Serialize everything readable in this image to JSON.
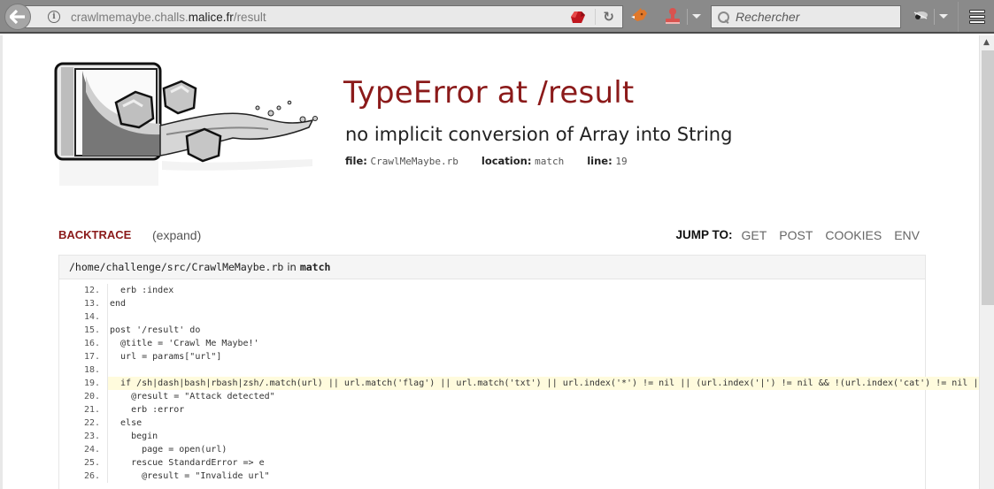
{
  "browser": {
    "url_prefix": "crawlmemaybe.challs.",
    "url_domain": "malice.fr",
    "url_suffix": "/result",
    "search_placeholder": "Rechercher"
  },
  "error": {
    "title": "TypeError at /result",
    "message": "no implicit conversion of Array into String",
    "file_label": "file:",
    "file": "CrawlMeMaybe.rb",
    "location_label": "location:",
    "location": "match",
    "line_label": "line:",
    "line": "19"
  },
  "backtrace": {
    "label": "BACKTRACE",
    "expand": "(expand)",
    "jump_label": "JUMP TO:",
    "jump_links": [
      "GET",
      "POST",
      "COOKIES",
      "ENV"
    ]
  },
  "frame": {
    "path": "/home/challenge/src/CrawlMeMaybe.rb",
    "in_text": "in",
    "function": "match",
    "highlight_line": "19",
    "lines": [
      {
        "n": "12.",
        "code": "  erb :index"
      },
      {
        "n": "13.",
        "code": "end"
      },
      {
        "n": "14.",
        "code": ""
      },
      {
        "n": "15.",
        "code": "post '/result' do"
      },
      {
        "n": "16.",
        "code": "  @title = 'Crawl Me Maybe!'"
      },
      {
        "n": "17.",
        "code": "  url = params[\"url\"]"
      },
      {
        "n": "18.",
        "code": ""
      },
      {
        "n": "19.",
        "code": "  if /sh|dash|bash|rbash|zsh/.match(url) || url.match('flag') || url.match('txt') || url.index('*') != nil || (url.index('|') != nil && !(url.index('cat') != nil ||"
      },
      {
        "n": "20.",
        "code": "    @result = \"Attack detected\""
      },
      {
        "n": "21.",
        "code": "    erb :error"
      },
      {
        "n": "22.",
        "code": "  else"
      },
      {
        "n": "23.",
        "code": "    begin"
      },
      {
        "n": "24.",
        "code": "      page = open(url)"
      },
      {
        "n": "25.",
        "code": "    rescue StandardError => e"
      },
      {
        "n": "26.",
        "code": "      @result = \"Invalide url\""
      }
    ]
  },
  "colors": {
    "accent": "#8b1a1a",
    "highlight": "#fffbdd"
  }
}
